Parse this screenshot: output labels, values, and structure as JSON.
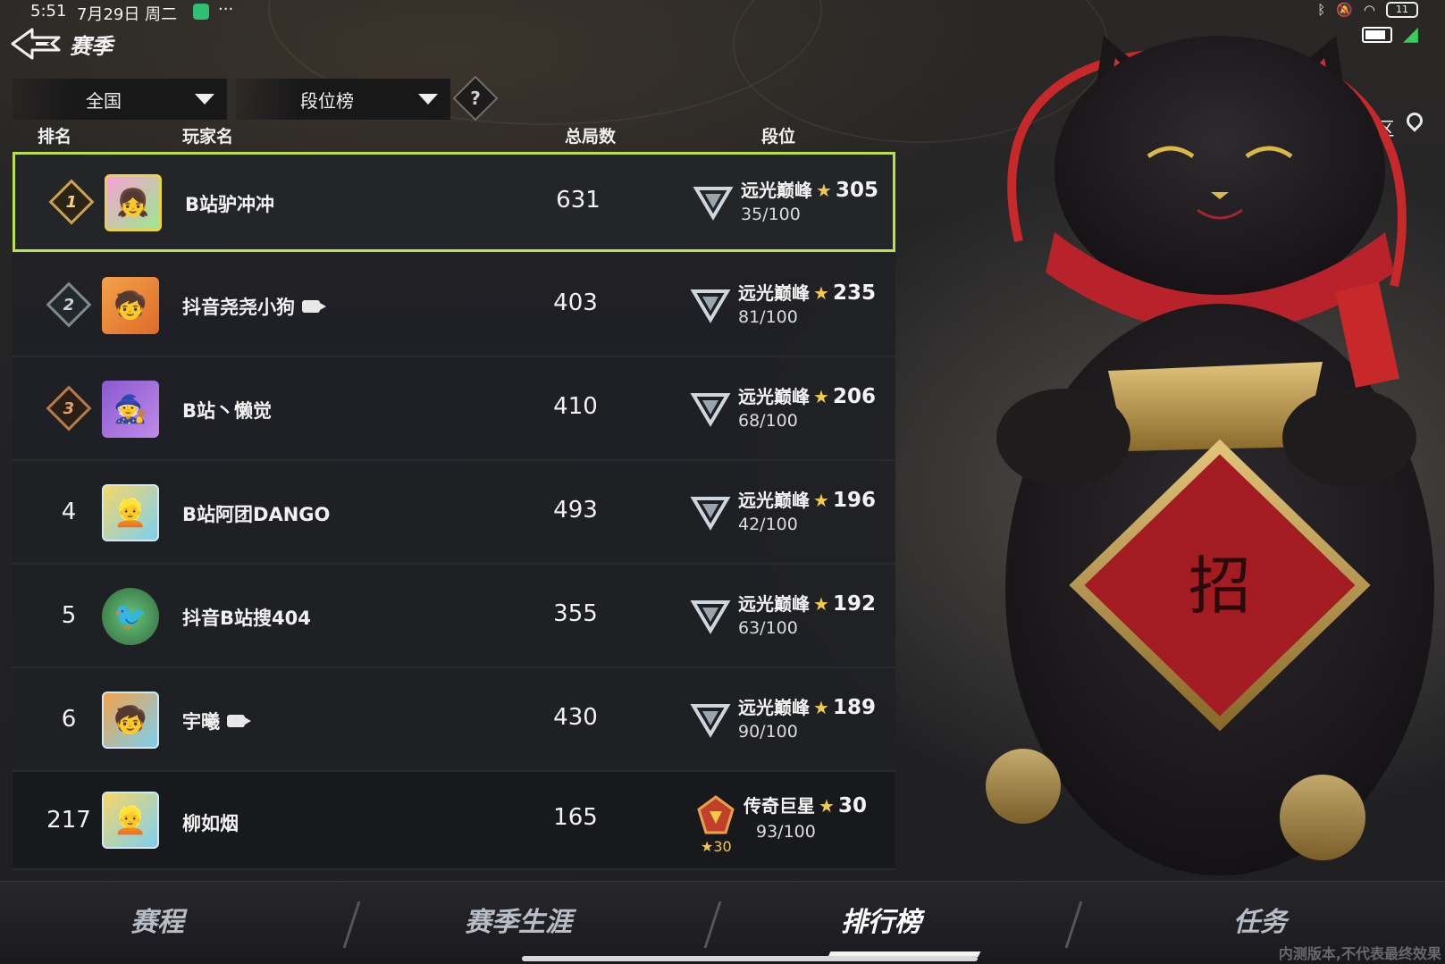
{
  "status_bar": {
    "time": "5:51",
    "date": "7月29日 周二",
    "more": "···",
    "battery_level": "11"
  },
  "header": {
    "title": "赛季"
  },
  "filters": {
    "region": "全国",
    "board": "段位榜",
    "help": "?"
  },
  "location": {
    "info_label": "i",
    "text": "北京-北京-海淀区"
  },
  "table": {
    "headers": {
      "rank": "排名",
      "player": "玩家名",
      "games": "总局数",
      "tier": "段位"
    },
    "rows": [
      {
        "rank": "1",
        "player": "B站驴冲冲",
        "games": "631",
        "tier": "远光巅峰",
        "points": "305",
        "progress": "35/100",
        "avatar": "pink-hair-avatar",
        "streamer": false
      },
      {
        "rank": "2",
        "player": "抖音尧尧小狗",
        "games": "403",
        "tier": "远光巅峰",
        "points": "235",
        "progress": "81/100",
        "avatar": "orange-hat-avatar",
        "streamer": true
      },
      {
        "rank": "3",
        "player": "B站丶懒觉",
        "games": "410",
        "tier": "远光巅峰",
        "points": "206",
        "progress": "68/100",
        "avatar": "purple-witch-avatar",
        "streamer": false
      },
      {
        "rank": "4",
        "player": "B站阿团DANGO",
        "games": "493",
        "tier": "远光巅峰",
        "points": "196",
        "progress": "42/100",
        "avatar": "blonde-avatar",
        "streamer": false
      },
      {
        "rank": "5",
        "player": "抖音B站搜404",
        "games": "355",
        "tier": "远光巅峰",
        "points": "192",
        "progress": "63/100",
        "avatar": "green-bird-avatar",
        "streamer": false
      },
      {
        "rank": "6",
        "player": "宇曦",
        "games": "430",
        "tier": "远光巅峰",
        "points": "189",
        "progress": "90/100",
        "avatar": "orange-hat-avatar",
        "streamer": true
      }
    ],
    "self_row": {
      "rank": "217",
      "player": "柳如烟",
      "games": "165",
      "tier": "传奇巨星",
      "points": "30",
      "badge": "★30",
      "progress": "93/100",
      "avatar": "blonde-avatar"
    }
  },
  "bottom_nav": {
    "tabs": [
      "赛程",
      "赛季生涯",
      "排行榜",
      "任务"
    ],
    "active_index": 2
  },
  "watermark": "内测版本,不代表最终效果",
  "colors": {
    "highlight_border": "#b9e04a",
    "star": "#f2c94c",
    "row_bg": "#202125"
  }
}
